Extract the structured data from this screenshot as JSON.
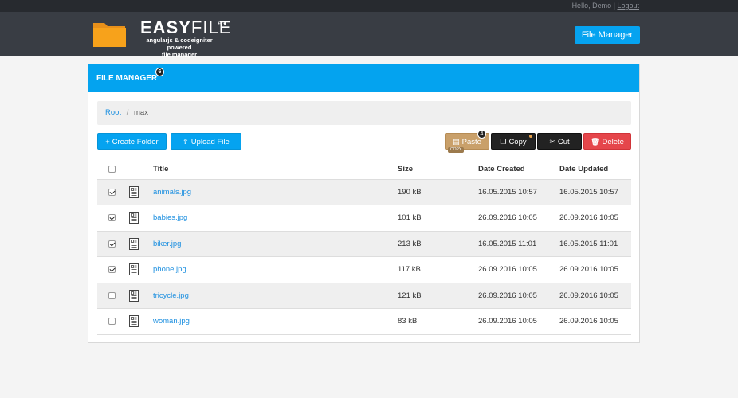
{
  "topbar": {
    "greeting": "Hello, Demo",
    "separator": "|",
    "logout_label": "Logout"
  },
  "brand": {
    "title_bold": "EASY",
    "title_rest": "FILE",
    "badges": "A ♦",
    "subtitle_line1": "angularjs & codeigniter powered",
    "subtitle_line2": "file manager"
  },
  "nav": {
    "file_manager_label": "File Manager"
  },
  "panel": {
    "title": "FILE MANAGER",
    "count": "6"
  },
  "breadcrumb": {
    "root": "Root",
    "separator": "/",
    "current": "max"
  },
  "toolbar": {
    "create_folder": "Create Folder",
    "upload_file": "Upload File",
    "paste": "Paste",
    "paste_count": "4",
    "paste_tag": "COPY",
    "copy": "Copy",
    "cut": "Cut",
    "delete": "Delete"
  },
  "table": {
    "headers": {
      "title": "Title",
      "size": "Size",
      "created": "Date Created",
      "updated": "Date Updated"
    },
    "rows": [
      {
        "checked": true,
        "title": "animals.jpg",
        "size": "190 kB",
        "created": "16.05.2015 10:57",
        "updated": "16.05.2015 10:57"
      },
      {
        "checked": true,
        "title": "babies.jpg",
        "size": "101 kB",
        "created": "26.09.2016 10:05",
        "updated": "26.09.2016 10:05"
      },
      {
        "checked": true,
        "title": "biker.jpg",
        "size": "213 kB",
        "created": "16.05.2015 11:01",
        "updated": "16.05.2015 11:01"
      },
      {
        "checked": true,
        "title": "phone.jpg",
        "size": "117 kB",
        "created": "26.09.2016 10:05",
        "updated": "26.09.2016 10:05"
      },
      {
        "checked": false,
        "title": "tricycle.jpg",
        "size": "121 kB",
        "created": "26.09.2016 10:05",
        "updated": "26.09.2016 10:05"
      },
      {
        "checked": false,
        "title": "woman.jpg",
        "size": "83 kB",
        "created": "26.09.2016 10:05",
        "updated": "26.09.2016 10:05"
      }
    ]
  },
  "colors": {
    "accent": "#04a3ef",
    "header": "#393d44",
    "paste": "#c9a06a",
    "delete": "#e5464b",
    "folder": "#f7a21b"
  },
  "icons": {
    "logo": "folder-icon",
    "create": "plus-icon",
    "upload": "upload-icon",
    "paste": "clipboard-icon",
    "copy": "copy-icon",
    "cut": "scissors-icon",
    "delete": "trash-icon",
    "file": "document-icon"
  }
}
